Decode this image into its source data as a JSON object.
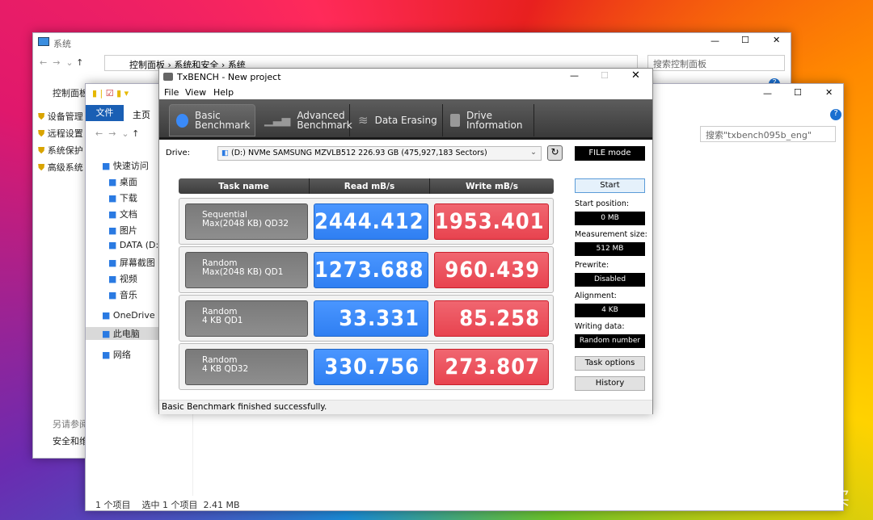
{
  "control_panel": {
    "title": "系统",
    "breadcrumb": [
      "控制面板",
      "系统和安全",
      "系统"
    ],
    "search_placeholder": "搜索控制面板",
    "side_header": "控制面板",
    "links": [
      "设备管理",
      "远程设置",
      "系统保护",
      "高级系统"
    ],
    "see_also": "另请参阅",
    "see_also_link": "安全和维"
  },
  "explorer": {
    "ribbon_tabs": [
      "文件",
      "主页"
    ],
    "search_placeholder": "搜索\"txbench095b_eng\"",
    "nav": [
      {
        "label": "快速访问",
        "icon": "star-icon"
      },
      {
        "label": "桌面",
        "icon": "desktop-icon"
      },
      {
        "label": "下载",
        "icon": "download-icon"
      },
      {
        "label": "文档",
        "icon": "document-icon"
      },
      {
        "label": "图片",
        "icon": "picture-icon"
      },
      {
        "label": "DATA (D:)",
        "icon": "drive-icon"
      },
      {
        "label": "屏幕截图",
        "icon": "folder-icon"
      },
      {
        "label": "视频",
        "icon": "video-icon"
      },
      {
        "label": "音乐",
        "icon": "music-icon"
      },
      {
        "label": "OneDrive",
        "icon": "cloud-icon"
      },
      {
        "label": "此电脑",
        "icon": "computer-icon"
      },
      {
        "label": "网络",
        "icon": "network-icon"
      }
    ],
    "status": {
      "items": "1 个项目",
      "selected": "选中 1 个项目",
      "size": "2.41 MB"
    }
  },
  "txbench": {
    "title": "TxBENCH - New project",
    "menu": [
      "File",
      "View",
      "Help"
    ],
    "tabs": [
      {
        "l1": "Basic",
        "l2": "Benchmark",
        "icon": "stopwatch-icon"
      },
      {
        "l1": "Advanced",
        "l2": "Benchmark",
        "icon": "bar-chart-icon"
      },
      {
        "l1": "Data Erasing",
        "l2": "",
        "icon": "eraser-icon"
      },
      {
        "l1": "Drive",
        "l2": "Information",
        "icon": "drive-info-icon"
      }
    ],
    "drive_label": "Drive:",
    "drive_value": "(D:) NVMe SAMSUNG MZVLB512  226.93 GB (475,927,183 Sectors)",
    "mode": "FILE mode",
    "headers": [
      "Task name",
      "Read mB/s",
      "Write mB/s"
    ],
    "rows": [
      {
        "l1": "Sequential",
        "l2": "Max(2048 KB) QD32",
        "read": "2444.412",
        "write": "1953.401"
      },
      {
        "l1": "Random",
        "l2": "Max(2048 KB) QD1",
        "read": "1273.688",
        "write": "960.439"
      },
      {
        "l1": "Random",
        "l2": "4 KB QD1",
        "read": "33.331",
        "write": "85.258"
      },
      {
        "l1": "Random",
        "l2": "4 KB QD32",
        "read": "330.756",
        "write": "273.807"
      }
    ],
    "start": "Start",
    "settings": [
      {
        "label": "Start position:",
        "value": "0 MB"
      },
      {
        "label": "Measurement size:",
        "value": "512 MB"
      },
      {
        "label": "Prewrite:",
        "value": "Disabled"
      },
      {
        "label": "Alignment:",
        "value": "4 KB"
      },
      {
        "label": "Writing data:",
        "value": "Random number"
      }
    ],
    "task_options": "Task options",
    "history": "History",
    "status": "Basic Benchmark finished successfully.",
    "colors": {
      "read": "#3a8af8",
      "write": "#ec5060"
    }
  },
  "watermark": "值 什么值得买"
}
